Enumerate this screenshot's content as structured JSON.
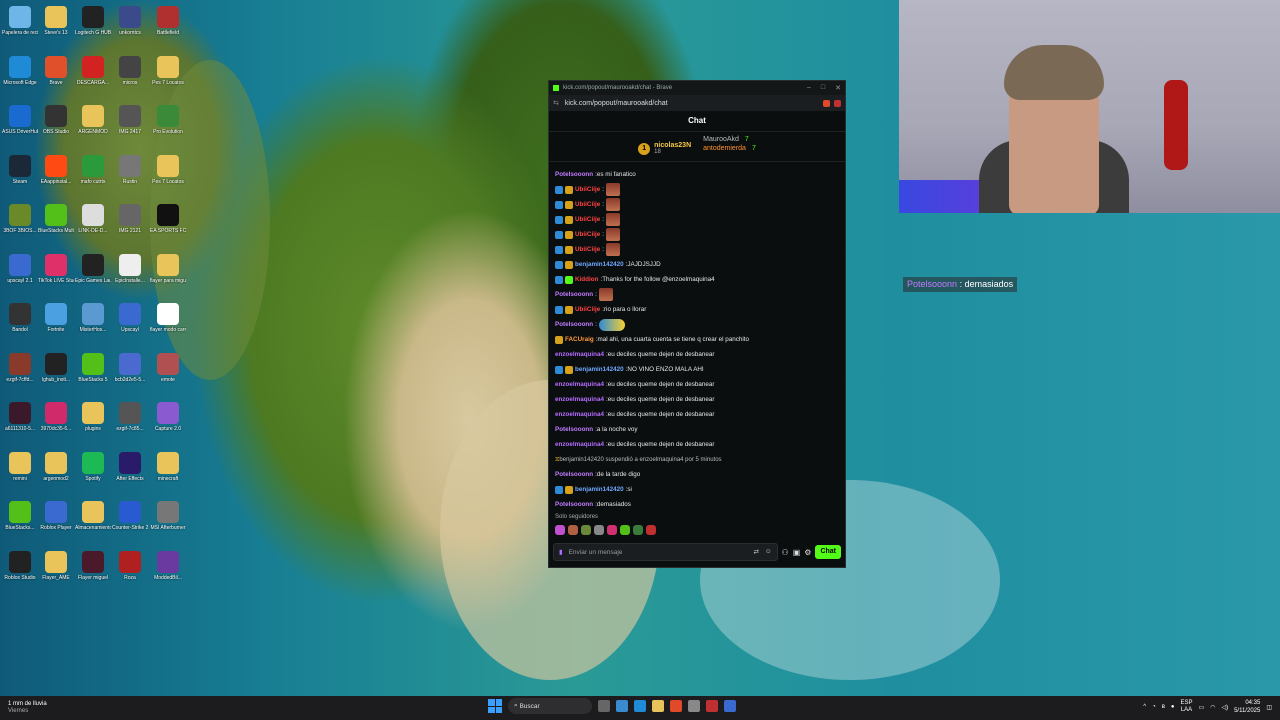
{
  "desktop": {
    "icons": [
      {
        "label": "Papelera de reciclaje",
        "color": "#6fb6e8"
      },
      {
        "label": "Steve's 13",
        "color": "#e8c45a"
      },
      {
        "label": "Logitech G HUB",
        "color": "#222222"
      },
      {
        "label": "unkorntcs",
        "color": "#3a4a8a"
      },
      {
        "label": "Battlefield",
        "color": "#b03030"
      },
      {
        "label": "Microsoft Edge",
        "color": "#1f8ad6"
      },
      {
        "label": "Brave",
        "color": "#e0502a"
      },
      {
        "label": "DESCARGA...",
        "color": "#d22222"
      },
      {
        "label": "micros",
        "color": "#444444"
      },
      {
        "label": "Pes 7 Locatos",
        "color": "#e8c45a"
      },
      {
        "label": "ASUS DriverHub",
        "color": "#1a6ad0"
      },
      {
        "label": "OBS Studio",
        "color": "#333333"
      },
      {
        "label": "ARGENMOD",
        "color": "#e8c45a"
      },
      {
        "label": "IMG 2417",
        "color": "#555555"
      },
      {
        "label": "Pro Evolution",
        "color": "#3a8a3a"
      },
      {
        "label": "Steam",
        "color": "#1b2838"
      },
      {
        "label": "EAappinstal...",
        "color": "#ff4a14"
      },
      {
        "label": "mafo cutrts",
        "color": "#2a9a3a"
      },
      {
        "label": "Rustin",
        "color": "#777777"
      },
      {
        "label": "Pes 7 Locatos",
        "color": "#e8c45a"
      },
      {
        "label": "3BOF 3BIOS...",
        "color": "#6a8a2a"
      },
      {
        "label": "BlueStacks Multi-Insta...",
        "color": "#53c01a"
      },
      {
        "label": "LINK-DE-D...",
        "color": "#dddddd"
      },
      {
        "label": "IMG 2121",
        "color": "#666666"
      },
      {
        "label": "EA SPORTS FC 26",
        "color": "#111111"
      },
      {
        "label": "upscayl 2.1",
        "color": "#3a6ad0"
      },
      {
        "label": "TikTok LIVE Studio",
        "color": "#e0306a"
      },
      {
        "label": "Epic Games Launcher",
        "color": "#222222"
      },
      {
        "label": "EpicInstalle...",
        "color": "#eeeeee"
      },
      {
        "label": "flayer para miguel",
        "color": "#e8c45a"
      },
      {
        "label": "Bandol",
        "color": "#333333"
      },
      {
        "label": "Fortnite",
        "color": "#4aa0e0"
      },
      {
        "label": "MisterHos...",
        "color": "#5a9ad0"
      },
      {
        "label": "Upscayl",
        "color": "#3a6ad0"
      },
      {
        "label": "flayer modo carrera",
        "color": "#ffffff"
      },
      {
        "label": "ezgif-7cffd...",
        "color": "#8a3a2a"
      },
      {
        "label": "lghub_insti...",
        "color": "#222222"
      },
      {
        "label": "BlueStacks 5",
        "color": "#53c01a"
      },
      {
        "label": "bcb2d2e5-5...",
        "color": "#4a6ad0"
      },
      {
        "label": "emote",
        "color": "#b05050"
      },
      {
        "label": "a6111310-5...",
        "color": "#3a1a2a"
      },
      {
        "label": "3970dc35-6...",
        "color": "#d02a6a"
      },
      {
        "label": "plugins",
        "color": "#e8c45a"
      },
      {
        "label": "ezgif-7c85...",
        "color": "#555555"
      },
      {
        "label": "Capture 2.0",
        "color": "#8a5ad0"
      },
      {
        "label": "remini",
        "color": "#e8c45a"
      },
      {
        "label": "argenmod2",
        "color": "#e8c45a"
      },
      {
        "label": "Spotify",
        "color": "#1db954"
      },
      {
        "label": "After Effects",
        "color": "#2a1a6a"
      },
      {
        "label": "minecraft",
        "color": "#e8c45a"
      },
      {
        "label": "BlueStacks...",
        "color": "#53c01a"
      },
      {
        "label": "Roblox Player",
        "color": "#3a6ad0"
      },
      {
        "label": "Almacenamiento automatic...",
        "color": "#e8c45a"
      },
      {
        "label": "Counter-Strike 2",
        "color": "#2a5ad0"
      },
      {
        "label": "MSI Afterburner",
        "color": "#777777"
      },
      {
        "label": "Roblox Studio",
        "color": "#222222"
      },
      {
        "label": "Flayer_AME",
        "color": "#e8c45a"
      },
      {
        "label": "Flayer miguel",
        "color": "#4a1a2a"
      },
      {
        "label": "Roza",
        "color": "#b02020"
      },
      {
        "label": "ModdedBil...",
        "color": "#6a3aa0"
      }
    ]
  },
  "browser": {
    "title": "kick.com/popout/maurooakd/chat - Brave",
    "url": "kick.com/popout/maurooakd/chat",
    "chat_header": "Chat",
    "top_gifter": {
      "rank": "1",
      "name": "nicolas23N",
      "count": "18"
    },
    "gifters_right": [
      {
        "name": "MaurooAkd",
        "count": "7"
      },
      {
        "name": "antodemierda",
        "count": "7"
      }
    ],
    "messages": [
      {
        "user": "Potelsooonn",
        "text": "es mi fanatico",
        "cls": "u-violet",
        "badges": []
      },
      {
        "user": "UbiiCiije",
        "text": "",
        "cls": "u-red",
        "badges": [
          "blue",
          "gold"
        ],
        "emote": true
      },
      {
        "user": "UbiiCiije",
        "text": "",
        "cls": "u-red",
        "badges": [
          "blue",
          "gold"
        ],
        "emote": true
      },
      {
        "user": "UbiiCiije",
        "text": "",
        "cls": "u-red",
        "badges": [
          "blue",
          "gold"
        ],
        "emote": true
      },
      {
        "user": "UbiiCiije",
        "text": "",
        "cls": "u-red",
        "badges": [
          "blue",
          "gold"
        ],
        "emote": true
      },
      {
        "user": "UbiiCiije",
        "text": "",
        "cls": "u-red",
        "badges": [
          "blue",
          "gold"
        ],
        "emote": true
      },
      {
        "user": "benjamin142420",
        "text": "JAJDJSJJD",
        "cls": "u-blue",
        "badges": [
          "blue",
          "gold"
        ]
      },
      {
        "user": "Kiddion",
        "text": "Thanks for the follow @enzoelmaquina4",
        "cls": "u-red",
        "badges": [
          "blue",
          "green"
        ]
      },
      {
        "user": "Potelsooonn",
        "text": "",
        "cls": "u-violet",
        "badges": [],
        "emote": true
      },
      {
        "user": "UbiiCiije",
        "text": "rio para o llorar",
        "cls": "u-red",
        "badges": [
          "blue",
          "gold"
        ]
      },
      {
        "user": "Potelsooonn",
        "text": "",
        "cls": "u-violet",
        "badges": [],
        "emote2": true
      },
      {
        "user": "FACUraig",
        "text": "mal ahi, una cuarta cuenta se tiene q crear el panchito",
        "cls": "u-orange",
        "badges": [
          "gold"
        ]
      },
      {
        "user": "enzoelmaquina4",
        "text": "eu deciles queme dejen de desbanear",
        "cls": "u-purple",
        "badges": []
      },
      {
        "user": "benjamin142420",
        "text": "NO VINO ENZO MALA AHI",
        "cls": "u-blue",
        "badges": [
          "blue",
          "gold"
        ]
      },
      {
        "user": "enzoelmaquina4",
        "text": "eu deciles queme dejen de desbanear",
        "cls": "u-purple",
        "badges": []
      },
      {
        "user": "enzoelmaquina4",
        "text": "eu deciles queme dejen de desbanear",
        "cls": "u-purple",
        "badges": []
      },
      {
        "user": "enzoelmaquina4",
        "text": "eu deciles queme dejen de desbanear",
        "cls": "u-purple",
        "badges": []
      },
      {
        "user": "Potelsooonn",
        "text": "a la noche voy",
        "cls": "u-violet",
        "badges": []
      },
      {
        "user": "enzoelmaquina4",
        "text": "eu deciles queme dejen de desbanear",
        "cls": "u-purple",
        "badges": []
      },
      {
        "user": "",
        "text": "benjamin142420 suspendió a enzoelmaquina4 por 5 minutos",
        "cls": "sys",
        "badges": [],
        "system": true
      },
      {
        "user": "Potelsooonn",
        "text": "de la tarde digo",
        "cls": "u-violet",
        "badges": []
      },
      {
        "user": "benjamin142420",
        "text": "si",
        "cls": "u-blue",
        "badges": [
          "blue",
          "gold"
        ]
      },
      {
        "user": "Potelsooonn",
        "text": "demasiados",
        "cls": "u-violet",
        "badges": []
      }
    ],
    "followers_only": "Solo seguidores",
    "input_placeholder": "Enviar un mensaje",
    "chat_button": "Chat"
  },
  "overlay": {
    "user": "Potelsooonn",
    "text": "demasiados"
  },
  "taskbar": {
    "weather_line1": "1 mm de lluvia",
    "weather_line2": "Viernes",
    "search": "Buscar",
    "lang": "ESP",
    "lang2": "LAA",
    "time": "04:35",
    "date": "5/11/2025"
  }
}
